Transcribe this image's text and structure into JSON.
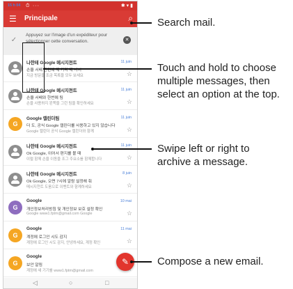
{
  "status_bar": {
    "time": "15 h 04",
    "alarm": "⏱",
    "dots": "···",
    "system_icons": "✱ ▾ ▮"
  },
  "app_bar": {
    "menu_icon": "☰",
    "title": "Principale",
    "search_icon": "⌕"
  },
  "tip": {
    "check_icon": "✓",
    "text": "Appuyez sur l'image d'un expéditeur pour sélectionner cette conversation.",
    "close_icon": "✕"
  },
  "messages": [
    {
      "avatar": "",
      "avatar_type": "person",
      "sender": "나한테 Google 메시지천트",
      "line2": "손을 서배 한편에 제 가다 때 나서",
      "line3": "지금 방문을 조금 목록을 모두 보세요",
      "time": "11 juin",
      "star": "☆"
    },
    {
      "avatar": "",
      "avatar_type": "person",
      "sender": "나한테 Google 메시지천트",
      "line2": "손을 서배와 한번에 팀",
      "line3": "손을 사용하지 왼쪽을 그런 팀을 확인하세요",
      "time": "11 juin",
      "star": "☆"
    },
    {
      "avatar": "G",
      "avatar_type": "orange",
      "sender": "Google 캘린더팀",
      "line2": "더 도, 공식 Google 캘린더를 사용하고 있지 않습니다",
      "line3": "Google 캘린더 공식 Google 캘린더와 함께",
      "time": "11 juin",
      "star": "☆"
    },
    {
      "avatar": "",
      "avatar_type": "person",
      "sender": "나한테 Google 메시지천트",
      "line2": "Ok Google, 이어서 편지를 볼 때",
      "line3": "이럴 함께 손을 이동을 조그 주요소를 함께합니다",
      "time": "11 juin",
      "star": "☆"
    },
    {
      "avatar": "",
      "avatar_type": "person",
      "sender": "나한테 Google 메시지천트",
      "line2": "Ok Google, 오면 7시에 알람 설정해 줘",
      "line3": "메시지천트 도움으로 이벤트와 함께하세요",
      "time": "8 juin",
      "star": "☆"
    },
    {
      "avatar": "G",
      "avatar_type": "purple",
      "sender": "Google",
      "line2": "개인정보처리방침 및 개인정보 보호 설정 확인",
      "line3": "Google www1.fptm@gmail.com Google",
      "time": "10 mai",
      "star": "☆"
    },
    {
      "avatar": "G",
      "avatar_type": "orange",
      "sender": "Google",
      "line2": "계정에 로그인 시도 감지",
      "line3": "계정에 로그인 시도 감지, 안녕하세요, 계정 확인",
      "time": "11 mai",
      "star": "☆"
    },
    {
      "avatar": "G",
      "avatar_type": "orange",
      "sender": "Google",
      "line2": "보안 알림",
      "line3": "계정에 새 기기를 www1.fptm@gmail.com",
      "time": "",
      "star": "☆"
    }
  ],
  "fab": {
    "icon": "✎"
  },
  "nav_bar": {
    "back_icon": "◁",
    "home_icon": "○",
    "recent_icon": "□"
  },
  "callouts": {
    "search": "Search mail.",
    "touch_hold_1": "Touch and hold to choose",
    "touch_hold_2": "multiple messages, then",
    "touch_hold_3": "select an option at the top.",
    "swipe_1": "Swipe left or right to",
    "swipe_2": "archive a message.",
    "compose": "Compose a new email."
  }
}
